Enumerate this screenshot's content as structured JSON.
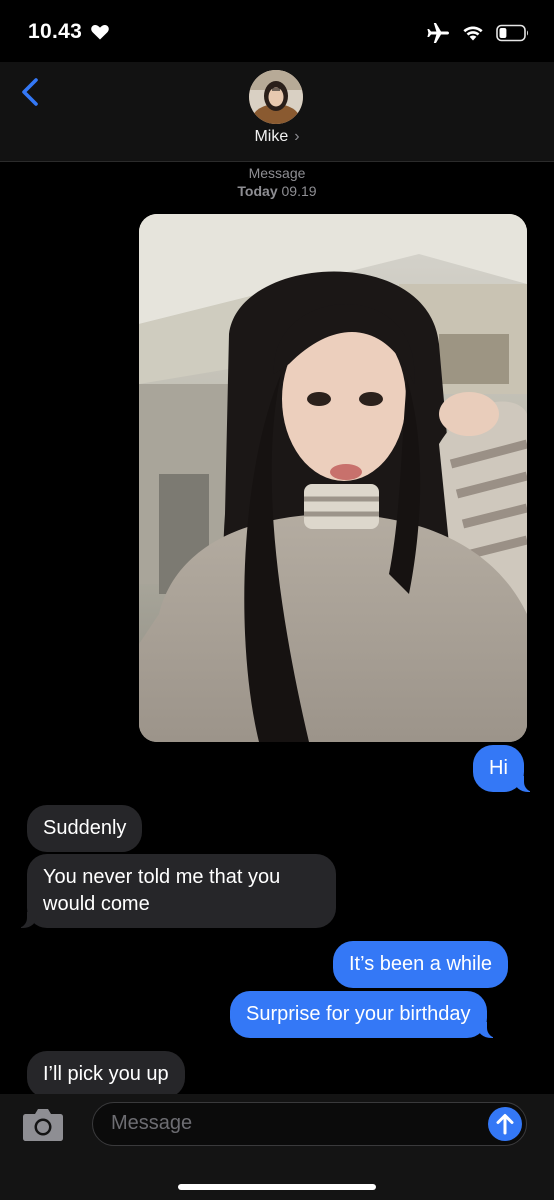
{
  "status": {
    "time": "10.43",
    "icons": [
      "heart-icon",
      "airplane-icon",
      "wifi-icon",
      "battery-icon"
    ],
    "battery_level": 0.3
  },
  "header": {
    "contact_name": "Mike",
    "name_chevron": "›",
    "back_icon": "chevron-left-icon"
  },
  "thread": {
    "service_label": "Message",
    "date_label": "Today",
    "time_label": "09.19"
  },
  "messages": [
    {
      "type": "photo",
      "direction": "sent"
    },
    {
      "type": "text",
      "direction": "sent",
      "text": "Hi"
    },
    {
      "type": "text",
      "direction": "received",
      "text": "Suddenly"
    },
    {
      "type": "text",
      "direction": "received",
      "text": "You never told me that you would come"
    },
    {
      "type": "text",
      "direction": "sent",
      "text": "It’s been a while"
    },
    {
      "type": "text",
      "direction": "sent",
      "text": "Surprise for your birthday"
    },
    {
      "type": "text",
      "direction": "received",
      "text": "I’ll pick you up"
    }
  ],
  "composer": {
    "placeholder": "Message",
    "camera_icon": "camera-icon",
    "send_icon": "arrow-up-icon"
  },
  "colors": {
    "accent": "#3478f6",
    "received_bubble": "#262629",
    "background": "#000000",
    "header": "#121212"
  }
}
